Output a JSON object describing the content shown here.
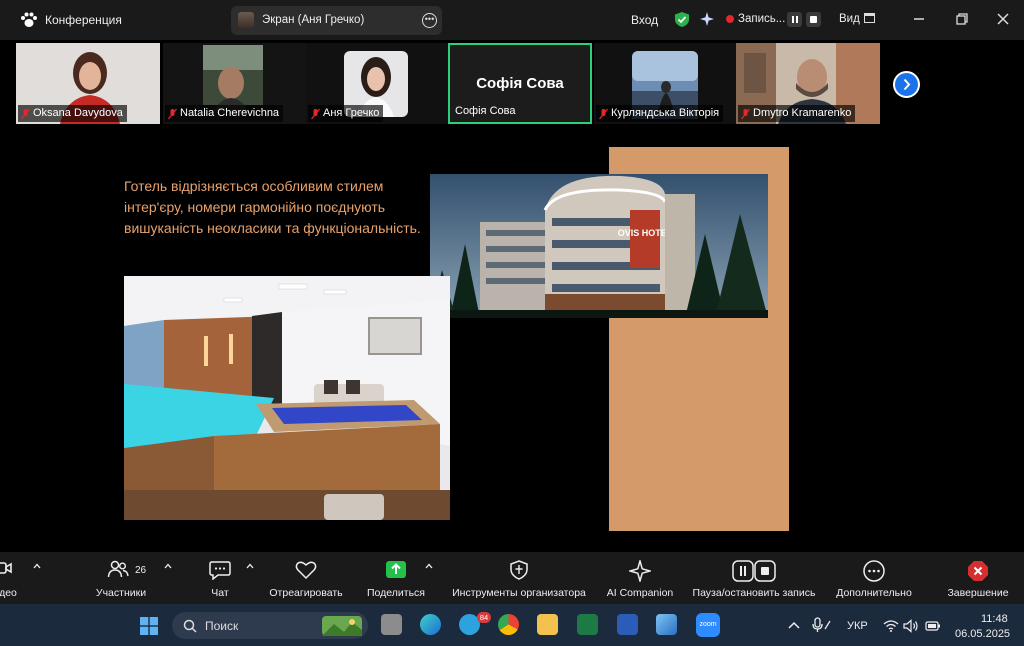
{
  "topbar": {
    "app_title": "Конференция",
    "share_label": "Экран (Аня Гречко)",
    "signin": "Вход",
    "recording_label": "Запись...",
    "view_label": "Вид"
  },
  "participants": [
    {
      "name": "Oksana Davydova",
      "muted": true
    },
    {
      "name": "Natalia Cherevichna",
      "muted": true
    },
    {
      "name": "Аня Гречко",
      "muted": true
    },
    {
      "name": "Софія Сова",
      "muted": false,
      "active": true
    },
    {
      "name": "Курляндська Вікторія",
      "muted": true
    },
    {
      "name": "Dmytro Kramarenko",
      "muted": true
    }
  ],
  "slide": {
    "text": "Готель відрізняється особливим стилем інтер'єру, номери гармонійно поєднують вишуканість неокласики та функціональність.",
    "hotel_sign": "OVIS HOTEL"
  },
  "toolbar": {
    "video": "део",
    "participants": "Участники",
    "participants_count": "26",
    "chat": "Чат",
    "react": "Отреагировать",
    "share": "Поделиться",
    "host_tools": "Инструменты организатора",
    "ai_companion": "AI Companion",
    "pause_stop_record": "Пауза/остановить запись",
    "more": "Дополнительно",
    "end": "Завершение"
  },
  "taskbar": {
    "search_placeholder": "Поиск",
    "telegram_badge": "84",
    "zoom_label": "zoom",
    "language": "УКР",
    "time": "11:48",
    "date": "06.05.2025"
  },
  "colors": {
    "accent_green": "#2bd07a",
    "slide_text": "#e8a26c",
    "slide_tan": "#d49a6a",
    "zoom_blue": "#1a73e8",
    "record_red": "#e0282e"
  }
}
